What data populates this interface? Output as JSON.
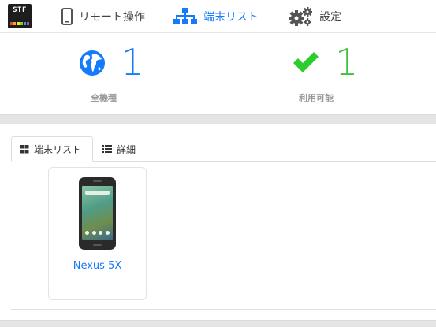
{
  "logo": {
    "text": "STF",
    "bar_colors": [
      "#e8443a",
      "#f6a623",
      "#f8e71c",
      "#7ed321",
      "#4a90e2",
      "#9b59b6"
    ]
  },
  "nav": {
    "remote": {
      "label": "リモート操作",
      "icon": "mobile-phone-icon"
    },
    "devices": {
      "label": "端末リスト",
      "icon": "sitemap-icon",
      "active": true
    },
    "settings": {
      "label": "設定",
      "icon": "gears-icon"
    }
  },
  "stats": {
    "total": {
      "value": "1",
      "label": "全機種",
      "icon": "globe-icon"
    },
    "usable": {
      "value": "1",
      "label": "利用可能",
      "icon": "check-icon"
    }
  },
  "tabs": [
    {
      "label": "端末リスト",
      "icon": "grid-icon",
      "active": true
    },
    {
      "label": "詳細",
      "icon": "list-icon",
      "active": false
    }
  ],
  "devices": [
    {
      "name": "Nexus 5X"
    }
  ],
  "colors": {
    "accent": "#157afb",
    "success": "#3cc13c",
    "muted": "#999999"
  }
}
